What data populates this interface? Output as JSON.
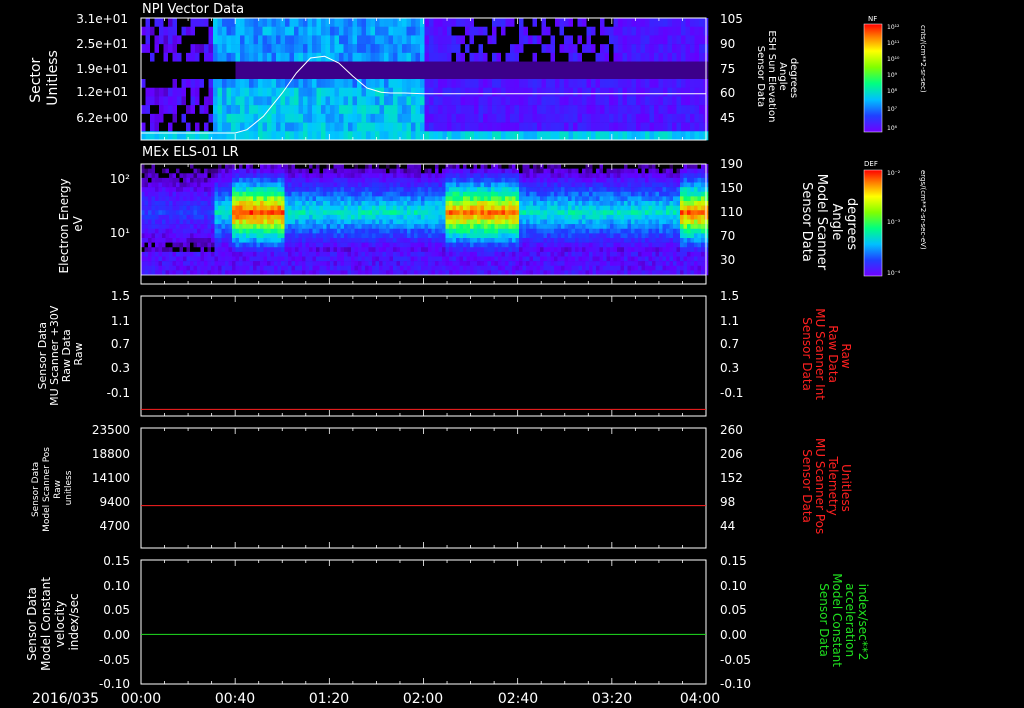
{
  "date_label": "2016/035",
  "time_ticks": [
    "00:00",
    "00:40",
    "01:20",
    "02:00",
    "02:40",
    "03:20",
    "04:00"
  ],
  "chart_data": [
    {
      "type": "heatmap",
      "title": "NPI Vector Data",
      "ylabel_left": [
        "Sector",
        "Unitless"
      ],
      "yticks_left": [
        "3.1e+01",
        "2.5e+01",
        "1.9e+01",
        "1.2e+01",
        "6.2e+00"
      ],
      "ylabel_right": [
        "Sensor Data",
        "ESH Sun Elevation",
        "Angle",
        "degrees"
      ],
      "yticks_right": [
        "105",
        "90",
        "75",
        "60",
        "45"
      ],
      "colorbar_label": "NF",
      "colorbar_unit": "cnts/(cm**2-sr-sec)",
      "colorbar_ticks": [
        "10¹²",
        "10¹¹",
        "10¹⁰",
        "10⁹",
        "10⁸",
        "10⁷",
        "10⁶"
      ],
      "overlay_series": {
        "units": "degrees",
        "x_minutes": [
          0,
          20,
          40,
          45,
          52,
          60,
          66,
          72,
          78,
          84,
          90,
          96,
          102,
          106,
          112,
          120,
          160,
          200,
          240
        ],
        "y": [
          36,
          36,
          36,
          38,
          46,
          60,
          72,
          81,
          82,
          78,
          70,
          63,
          60.5,
          60,
          60,
          59.5,
          59.5,
          59.5,
          59.5
        ]
      }
    },
    {
      "type": "heatmap",
      "title": "MEx ELS-01 LR",
      "ylabel_left": [
        "Electron Energy",
        "eV"
      ],
      "yticks_left": [
        "10²",
        "10¹"
      ],
      "ylabel_right": [
        "Sensor Data",
        "Model Scanner",
        "Angle",
        "degrees"
      ],
      "yticks_right": [
        "190",
        "150",
        "110",
        "70",
        "30"
      ],
      "colorbar_label": "DEF",
      "colorbar_unit": "ergs/(cm**2-sr-sec-eV)",
      "colorbar_ticks": [
        "10⁻²",
        "10⁻³",
        "10⁻⁴"
      ]
    },
    {
      "type": "line",
      "ylabel_left": [
        "Sensor Data",
        "MU Scanner +30V",
        "Raw Data",
        "Raw"
      ],
      "yticks_left": [
        "1.5",
        "1.1",
        "0.7",
        "0.3",
        "-0.1"
      ],
      "ylabel_right": [
        "Sensor Data",
        "MU Scanner Int",
        "Raw Data",
        "Raw"
      ],
      "yticks_right": [
        "1.5",
        "1.1",
        "0.7",
        "0.3",
        "-0.1"
      ],
      "ylim": [
        -0.3,
        1.5
      ],
      "series": [
        {
          "color": "#ff2020",
          "y_const": -0.2
        }
      ],
      "right_label_color": "#ff2020"
    },
    {
      "type": "line",
      "ylabel_left": [
        "Sensor Data",
        "Model Scanner Pos",
        "Raw",
        "unitless"
      ],
      "yticks_left": [
        "23500",
        "18800",
        "14100",
        "9400",
        "4700"
      ],
      "ylabel_right": [
        "Sensor Data",
        "MU Scanner Pos",
        "Telemetry",
        "Unitless"
      ],
      "yticks_right": [
        "260",
        "206",
        "152",
        "98",
        "44"
      ],
      "ylim": [
        0,
        23500
      ],
      "series": [
        {
          "color": "#ff2020",
          "y_const": 8300
        }
      ],
      "right_label_color": "#ff2020"
    },
    {
      "type": "line",
      "ylabel_left": [
        "Sensor Data",
        "Model Constant",
        "velocity",
        "index/sec"
      ],
      "yticks_left": [
        "0.15",
        "0.10",
        "0.05",
        "0.00",
        "-0.05",
        "-0.10"
      ],
      "ylabel_right": [
        "Sensor Data",
        "Model Constant",
        "acceleration",
        "index/sec**2"
      ],
      "yticks_right": [
        "0.15",
        "0.10",
        "0.05",
        "0.00",
        "-0.05",
        "-0.10"
      ],
      "ylim": [
        -0.1,
        0.15
      ],
      "series": [
        {
          "color": "#20e020",
          "y_const": 0.0
        }
      ],
      "right_label_color": "#20e020"
    }
  ]
}
